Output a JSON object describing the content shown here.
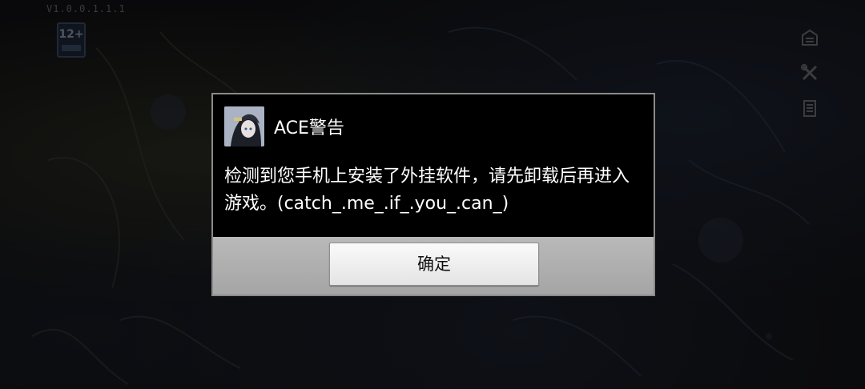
{
  "status": {
    "version_text": "V1.0.0.1.1.1"
  },
  "age_rating": {
    "label": "12+"
  },
  "side_icons": [
    "announcement-icon",
    "settings-icon",
    "notice-icon"
  ],
  "dialog": {
    "title": "ACE警告",
    "app_icon": "game-avatar-icon",
    "message": "检测到您手机上安装了外挂软件，请先卸载后再进入游戏。(catch_.me_.if_.you_.can_)",
    "ok_label": "确定"
  },
  "colors": {
    "dialog_background": "#000000",
    "dialog_border": "#8a8a8a",
    "footer_background": "#b0b0b0",
    "button_background": "#f2f2f2",
    "text_primary": "#ffffff"
  }
}
